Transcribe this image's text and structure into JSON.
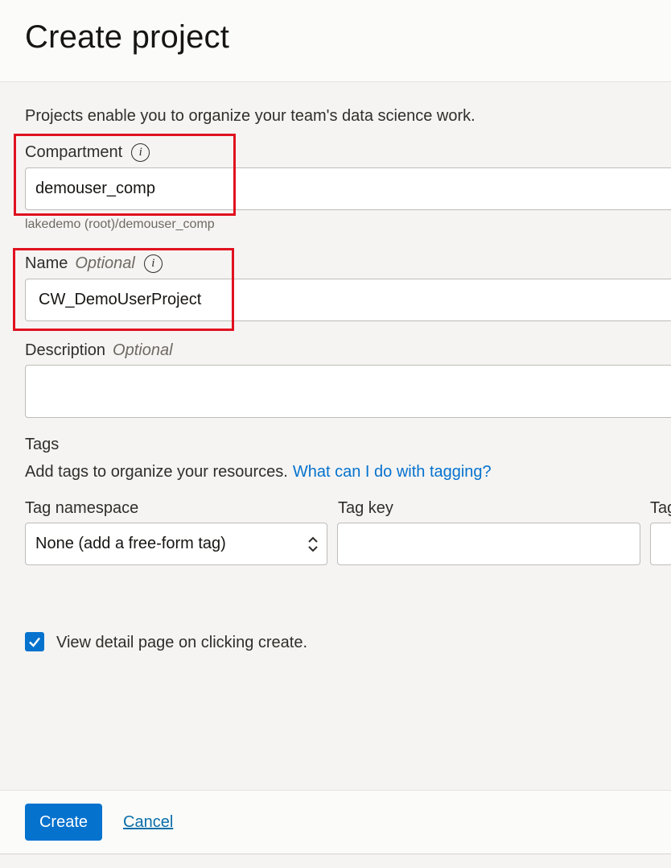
{
  "header": {
    "title": "Create project"
  },
  "intro": "Projects enable you to organize your team's data science work.",
  "compartment": {
    "label": "Compartment",
    "value": "demouser_comp",
    "path_hint": "lakedemo (root)/demouser_comp"
  },
  "name": {
    "label": "Name",
    "optional": "Optional",
    "value": "CW_DemoUserProject"
  },
  "description": {
    "label": "Description",
    "optional": "Optional",
    "value": ""
  },
  "tags": {
    "heading": "Tags",
    "help_text": "Add tags to organize your resources.",
    "help_link": "What can I do with tagging?",
    "namespace_label": "Tag namespace",
    "namespace_value": "None (add a free-form tag)",
    "key_label": "Tag key",
    "value_label": "Tag value",
    "key_value": "",
    "value_value": ""
  },
  "view_detail": {
    "checked": true,
    "label": "View detail page on clicking create."
  },
  "footer": {
    "create_label": "Create",
    "cancel_label": "Cancel"
  },
  "colors": {
    "accent": "#0572ce",
    "highlight": "#e0111f",
    "link": "#0572ce"
  }
}
